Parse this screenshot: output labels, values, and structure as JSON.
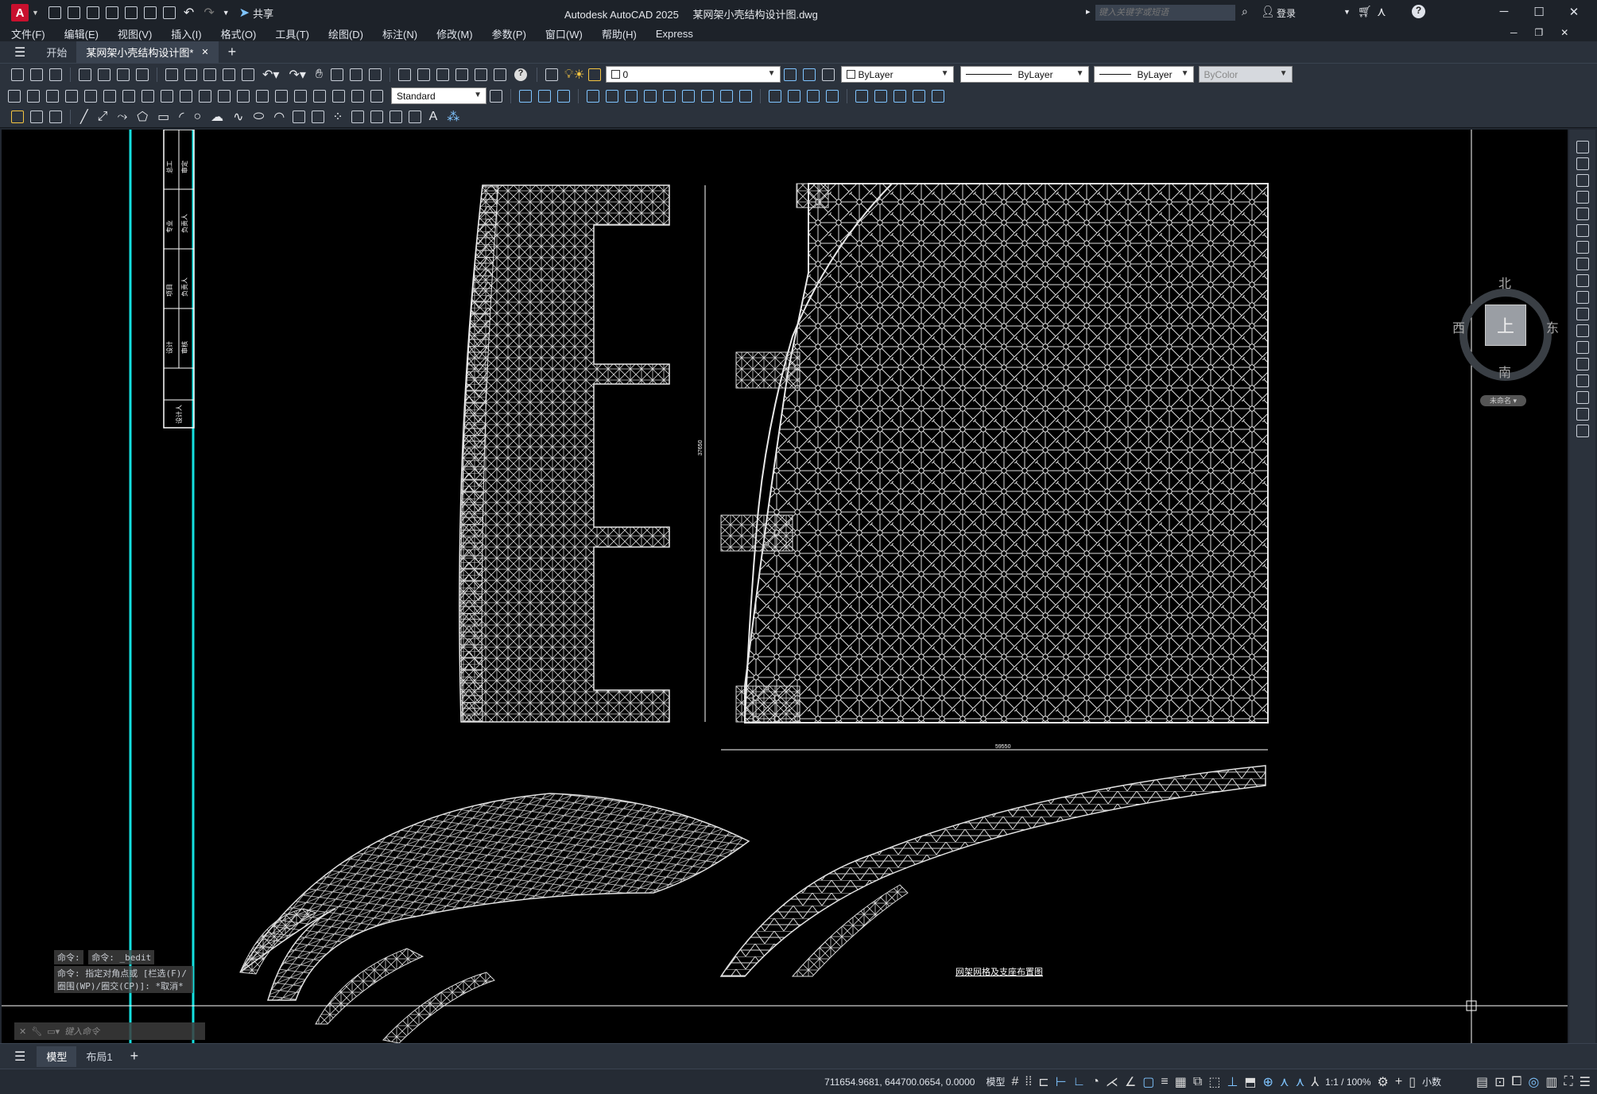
{
  "app": {
    "title": "Autodesk AutoCAD 2025",
    "document": "某网架小壳结构设计图.dwg",
    "share": "共享",
    "search_placeholder": "键入关键字或短语",
    "login": "登录"
  },
  "menu": [
    "文件(F)",
    "编辑(E)",
    "视图(V)",
    "插入(I)",
    "格式(O)",
    "工具(T)",
    "绘图(D)",
    "标注(N)",
    "修改(M)",
    "参数(P)",
    "窗口(W)",
    "帮助(H)",
    "Express"
  ],
  "tabs": {
    "start": "开始",
    "active": "某网架小壳结构设计图*"
  },
  "layer": {
    "current": "0"
  },
  "properties": {
    "color": "ByLayer",
    "linetype": "ByLayer",
    "lineweight": "ByLayer",
    "plotstyle": "ByColor"
  },
  "style": {
    "text_style": "Standard"
  },
  "viewcube": {
    "north": "北",
    "south": "南",
    "east": "东",
    "west": "西",
    "top": "上",
    "wcs": "未命名"
  },
  "drawing": {
    "vertical_dim": "37650",
    "horizontal_dim": "59550",
    "plan_title": "网架网格及支座布置图",
    "title_block_labels": [
      "总工",
      "审定",
      "专业",
      "负责人",
      "项目",
      "负责人",
      "设计",
      "审核",
      "校对",
      "设计人"
    ]
  },
  "command": {
    "history": [
      "命令:",
      "命令: _bedit",
      "命令: 指定对角点或 [栏选(F)/圈围(WP)/圈交(CP)]: *取消*"
    ],
    "placeholder": "键入命令"
  },
  "layout_tabs": [
    "模型",
    "布局1"
  ],
  "status": {
    "coords": "711654.9681, 644700.0654, 0.0000",
    "model": "模型",
    "scale": "1:1 / 100%",
    "units": "小数"
  }
}
